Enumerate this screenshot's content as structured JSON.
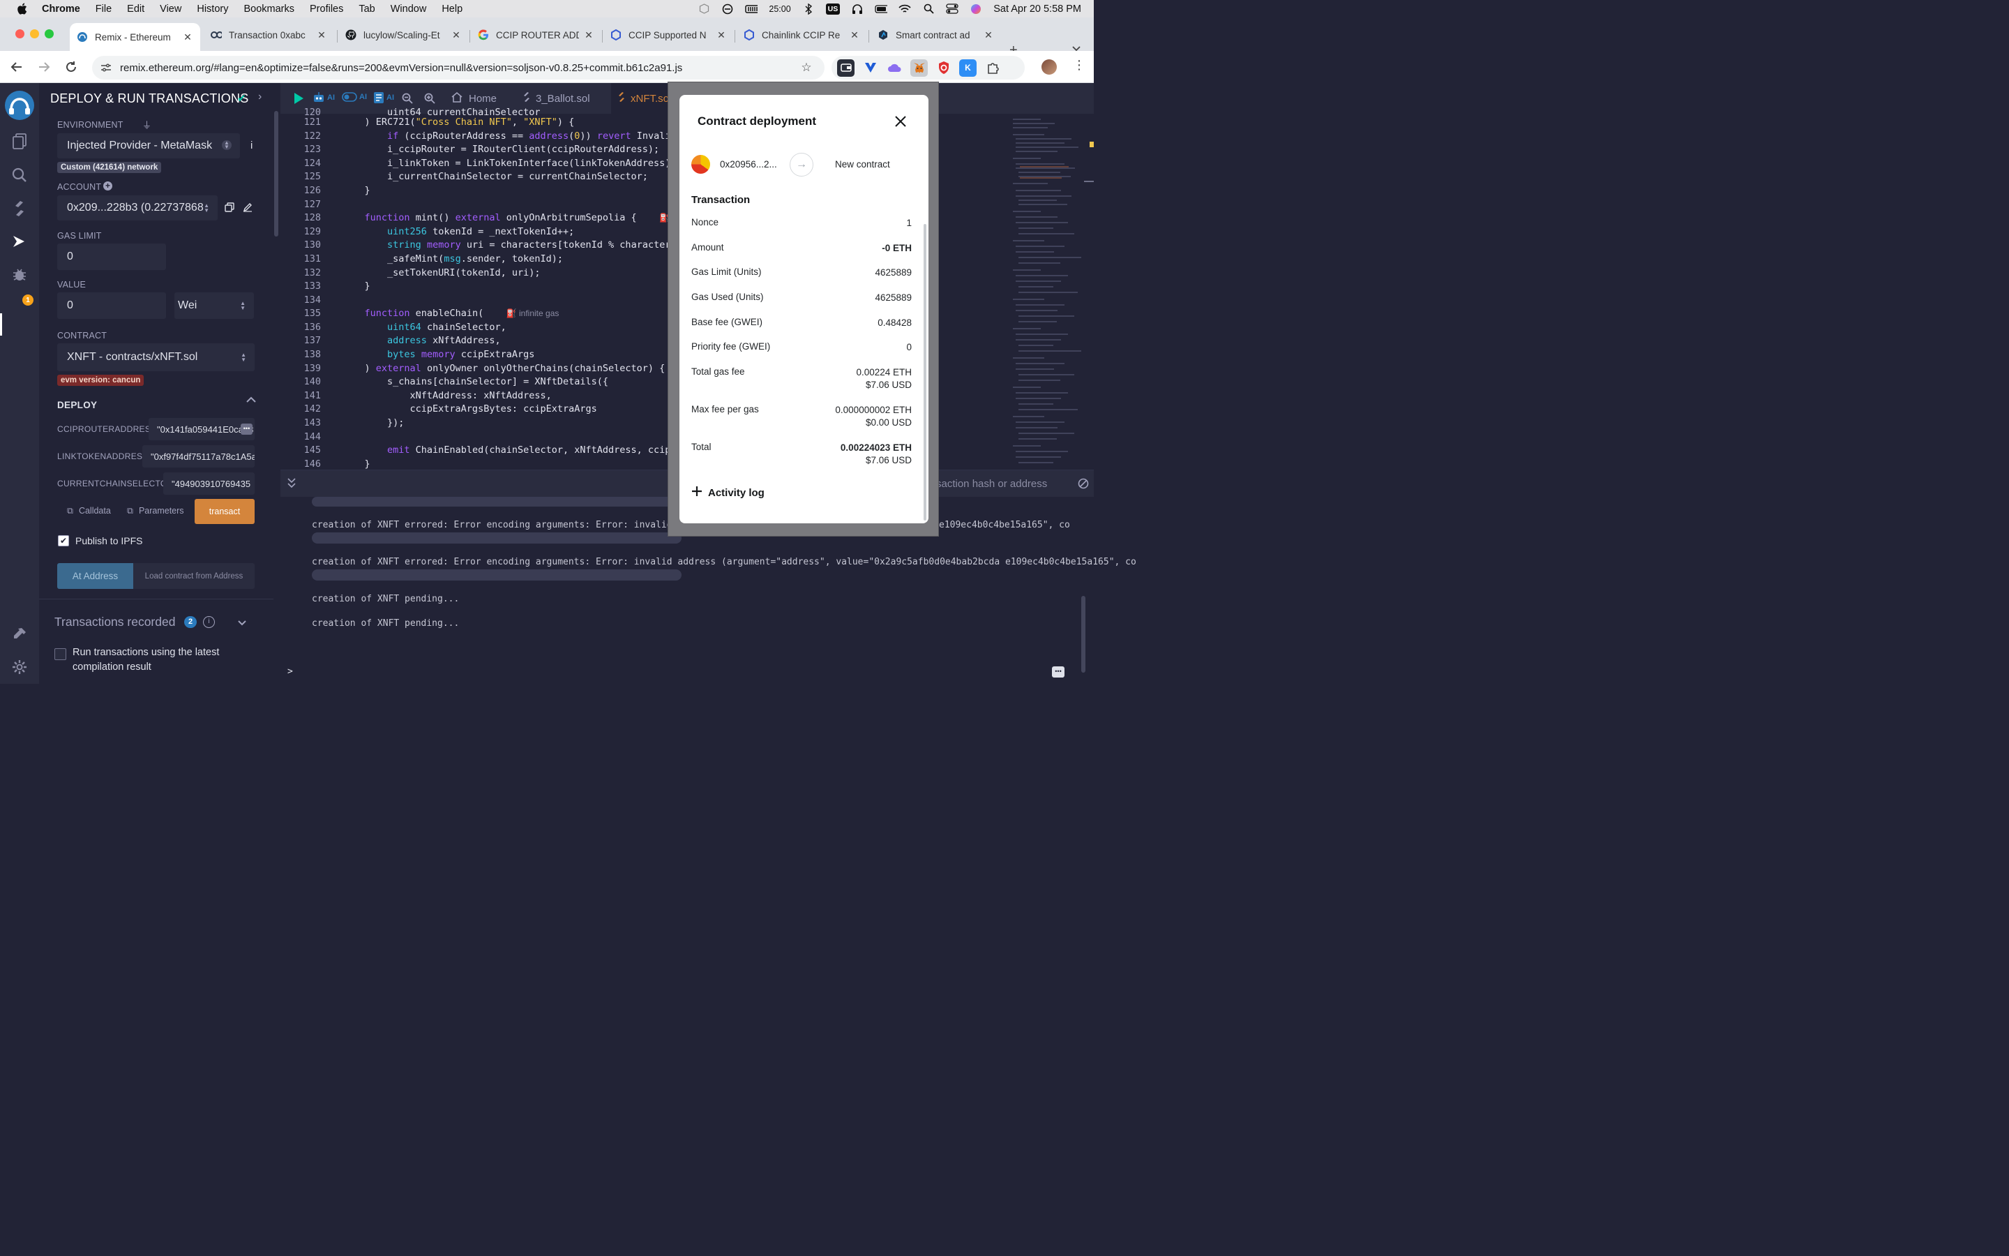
{
  "menubar": {
    "app": "Chrome",
    "items": [
      "File",
      "Edit",
      "View",
      "History",
      "Bookmarks",
      "Profiles",
      "Tab",
      "Window",
      "Help"
    ],
    "timer": "25:00",
    "keyboard": "US",
    "datetime": "Sat Apr 20  5:58 PM"
  },
  "tabs": [
    {
      "title": "Remix - Ethereum",
      "icon": "remix-icon"
    },
    {
      "title": "Transaction 0xabc",
      "icon": "etherscan-icon"
    },
    {
      "title": "lucylow/Scaling-Et",
      "icon": "github-icon"
    },
    {
      "title": "CCIP ROUTER ADD",
      "icon": "google-icon"
    },
    {
      "title": "CCIP Supported N",
      "icon": "chainlink-icon"
    },
    {
      "title": "Chainlink CCIP Re",
      "icon": "chainlink-icon"
    },
    {
      "title": "Smart contract ad",
      "icon": "arbitrum-icon"
    }
  ],
  "url": "remix.ethereum.org/#lang=en&optimize=false&runs=200&evmVersion=null&version=soljson-v0.8.25+commit.b61c2a91.js",
  "sidepanel": {
    "title": "DEPLOY & RUN TRANSACTIONS",
    "environment_label": "ENVIRONMENT",
    "environment_value": "Injected Provider - MetaMask",
    "network_tag": "Custom (421614) network",
    "account_label": "ACCOUNT",
    "account_value": "0x209...228b3 (0.22737868",
    "gas_limit_label": "GAS LIMIT",
    "gas_limit_value": "0",
    "value_label": "VALUE",
    "value_value": "0",
    "value_unit": "Wei",
    "contract_label": "CONTRACT",
    "contract_value": "XNFT - contracts/xNFT.sol",
    "evm_tag": "evm version: cancun",
    "deploy_label": "DEPLOY",
    "params": [
      {
        "name": "CCIPROUTERADDRESS:",
        "value": "\"0x141fa059441E0ca23"
      },
      {
        "name": "LINKTOKENADDRESS:",
        "value": "\"0xf97f4df75117a78c1A5a"
      },
      {
        "name": "CURRENTCHAINSELECTOR:",
        "value": "\"494903910769435"
      }
    ],
    "calldata_label": "Calldata",
    "parameters_label": "Parameters",
    "transact_label": "transact",
    "publish_label": "Publish to IPFS",
    "at_address_label": "At Address",
    "load_contract_label": "Load contract from Address",
    "transactions_recorded_label": "Transactions recorded",
    "transactions_recorded_count": "2",
    "run_latest_label": "Run transactions using the latest compilation result"
  },
  "iconpanel": {
    "badge": "1"
  },
  "editor": {
    "tabs": [
      "Home",
      "3_Ballot.sol",
      "xNFT.sol"
    ],
    "ai_label": "AI",
    "gas_infinite": "infinite gas",
    "gas_infinite_short": "inf"
  },
  "terminal": {
    "search_placeholder": "saction hash or address",
    "lines": [
      "creation of XNFT errored: Error encoding arguments: Error: invalid addre",
      "creation of XNFT errored: Error encoding arguments: Error: invalid address (argument=\"address\", value=\"0x2a9c5afb0d0e4bab2bcda e109ec4b0c4be15a165\", co",
      "creation of XNFT pending...",
      "creation of XNFT pending..."
    ],
    "line1_tail": "e109ec4b0c4be15a165\", co",
    "prompt": ">"
  },
  "metamask": {
    "title": "Contract deployment",
    "from": "0x20956...2...",
    "to": "New contract",
    "section": "Transaction",
    "rows": [
      {
        "k": "Nonce",
        "v": "1",
        "v2": ""
      },
      {
        "k": "Amount",
        "v": "-0 ETH",
        "v2": ""
      },
      {
        "k": "Gas Limit (Units)",
        "v": "4625889",
        "v2": ""
      },
      {
        "k": "Gas Used (Units)",
        "v": "4625889",
        "v2": ""
      },
      {
        "k": "Base fee (GWEI)",
        "v": "0.48428",
        "v2": ""
      },
      {
        "k": "Priority fee (GWEI)",
        "v": "0",
        "v2": ""
      },
      {
        "k": "Total gas fee",
        "v": "0.00224 ETH",
        "v2": "$7.06 USD"
      },
      {
        "k": "Max fee per gas",
        "v": "0.000000002 ETH",
        "v2": "$0.00 USD"
      },
      {
        "k": "Total",
        "v": "0.00224023 ETH",
        "v2": "$7.06 USD"
      }
    ],
    "activity": "Activity log"
  },
  "colors": {
    "remix_bg": "#222336",
    "remix_panel": "#2a2c3f",
    "transact": "#d4853c",
    "at_address": "#3b6a8f",
    "accent_blue": "#2b7bbd"
  }
}
